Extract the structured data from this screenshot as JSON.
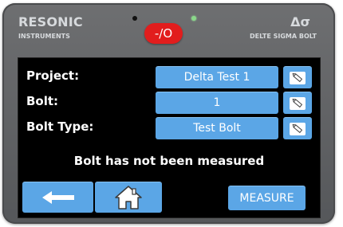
{
  "header": {
    "brand_name": "RESONIC",
    "brand_sub": "INSTRUMENTS",
    "product_symbol": "Δσ",
    "product_name": "DELTE SIGMA BOLT",
    "status_indicator": "-/O",
    "status_color": "#e21d1d"
  },
  "form": {
    "rows": [
      {
        "label": "Project:",
        "value": "Delta Test 1"
      },
      {
        "label": "Bolt:",
        "value": "1"
      },
      {
        "label": "Bolt Type:",
        "value": "Test Bolt"
      }
    ]
  },
  "status_message": "Bolt has not been measured",
  "footer": {
    "back_icon": "left-arrow-icon",
    "home_icon": "home-icon",
    "measure_label": "MEASURE"
  },
  "colors": {
    "accent": "#5ba6e6",
    "screen_bg": "#000000",
    "bezel": "#5e6063"
  }
}
